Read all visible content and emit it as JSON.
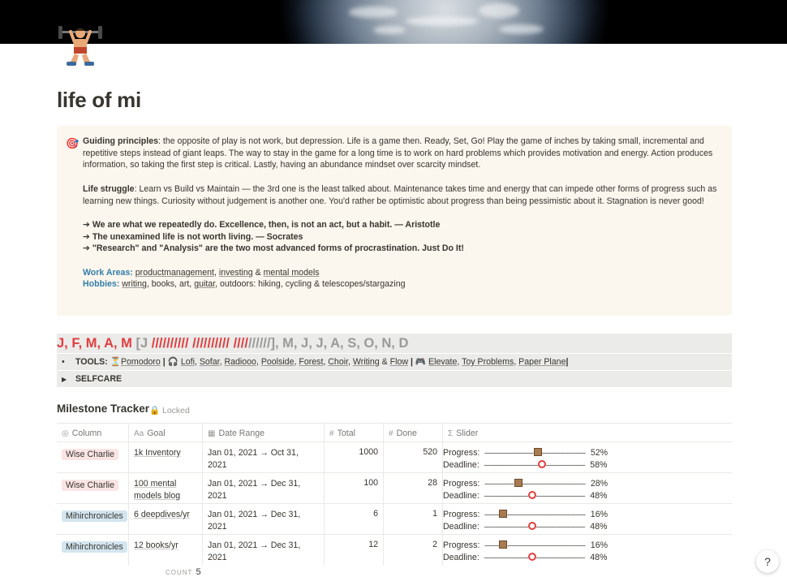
{
  "page": {
    "title": "life of mi",
    "cover": "earth-cover-image",
    "icon": "weightlifter-icon"
  },
  "callout": {
    "icon": "target-icon",
    "guiding_heading": "Guiding principles",
    "guiding_text": ": the opposite of play is not work, but depression. Life is a game then. Ready, Set, Go! Play the game of inches by taking small, incremental and repetitive steps instead of giant leaps. The way to stay in the game for a long time is to work on hard problems which provides motivation and energy. Action produces information, so taking the first step is critical. Lastly, having an abundance mindset over scarcity mindset.",
    "struggle_heading": "Life struggle",
    "struggle_text": ": Learn vs Build vs Maintain — the 3rd one is the least talked about. Maintenance takes time and energy that can impede other forms of progress such as learning new things. Curiosity without judgement is another one. You'd rather be optimistic about progress than being pessimistic about it. Stagnation is never good!",
    "quotes": [
      "➔ We are what we repeatedly do. Excellence, then, is not an act, but a habit. — Aristotle",
      "➔ The unexamined life is not worth living. — Socrates",
      "➔ \"Research\" and \"Analysis\" are the two most advanced forms of procrastination. Just Do It!"
    ],
    "work_label": "Work Areas:",
    "work_links": [
      "productmanagement",
      "investing",
      "mental models"
    ],
    "work_sep1": ", ",
    "work_sep2": " & ",
    "hobbies_label": "Hobbies:",
    "hobbies_link1": "writing",
    "hobbies_mid": ", books, art, ",
    "hobbies_link2": "guitar",
    "hobbies_rest": ", outdoors: hiking, cycling & telescopes/stargazing"
  },
  "year_bar": {
    "done": "J, F, M, A, M ",
    "bracket_open": "[J ",
    "progress_red": "////////// ////////// ////",
    "progress_grey": "//////",
    "rest": "], M, J, J, A, S, O, N, D"
  },
  "tools": {
    "label": "TOOLS:",
    "pomodoro": "Pomodoro",
    "sep": " | ",
    "music": [
      "Lofi",
      "Sofar",
      "Radiooo",
      "Poolside",
      "Forest",
      "Choir",
      "Writing",
      "Flow"
    ],
    "games": [
      "Elevate",
      "Toy Problems",
      "Paper Plane"
    ]
  },
  "selfcare": {
    "label": "SELFCARE"
  },
  "database": {
    "title": "Milestone Tracker",
    "lock_label": "Locked",
    "columns": [
      "Column",
      "Goal",
      "Date Range",
      "Total",
      "Done",
      "Slider"
    ],
    "rows": [
      {
        "column": "Wise Charlie",
        "tag_color": "#fbe4e4",
        "goal": "1k Inventory",
        "date": "Jan 01, 2021 → Oct 31, 2021",
        "total": "1000",
        "done": "520",
        "progress_label": "Progress:",
        "progress_before": "––––––––––",
        "progress_after": "–––––––––",
        "progress_pct": "52%",
        "deadline_label": "Deadline:",
        "deadline_before": "–––––––––––",
        "deadline_after": "––––––––",
        "deadline_pct": "58%"
      },
      {
        "column": "Wise Charlie",
        "tag_color": "#fbe4e4",
        "goal": "100 mental models blog",
        "date": "Jan 01, 2021 → Dec 31, 2021",
        "total": "100",
        "done": "28",
        "progress_label": "Progress:",
        "progress_before": "––––––",
        "progress_after": "–––––––––––––",
        "progress_pct": "28%",
        "deadline_label": "Deadline:",
        "deadline_before": "–––––––––",
        "deadline_after": "––––––––––",
        "deadline_pct": "48%"
      },
      {
        "column": "Mihirchronicles",
        "tag_color": "#d3e5ef",
        "goal": "6 deepdives/yr",
        "date": "Jan 01, 2021 → Dec 31, 2021",
        "total": "6",
        "done": "1",
        "progress_label": "Progress:",
        "progress_before": "–––",
        "progress_after": "––––––––––––––––",
        "progress_pct": "16%",
        "deadline_label": "Deadline:",
        "deadline_before": "–––––––––",
        "deadline_after": "––––––––––",
        "deadline_pct": "48%"
      },
      {
        "column": "Mihirchronicles",
        "tag_color": "#d3e5ef",
        "goal": "12 books/yr",
        "date": "Jan 01, 2021 → Dec 31, 2021",
        "total": "12",
        "done": "2",
        "progress_label": "Progress:",
        "progress_before": "–––",
        "progress_after": "––––––––––––––––",
        "progress_pct": "16%",
        "deadline_label": "Deadline:",
        "deadline_before": "–––––––––",
        "deadline_after": "––––––––––",
        "deadline_pct": "48%"
      }
    ],
    "count_label": "COUNT",
    "count_value": "5"
  },
  "help": {
    "label": "?"
  }
}
